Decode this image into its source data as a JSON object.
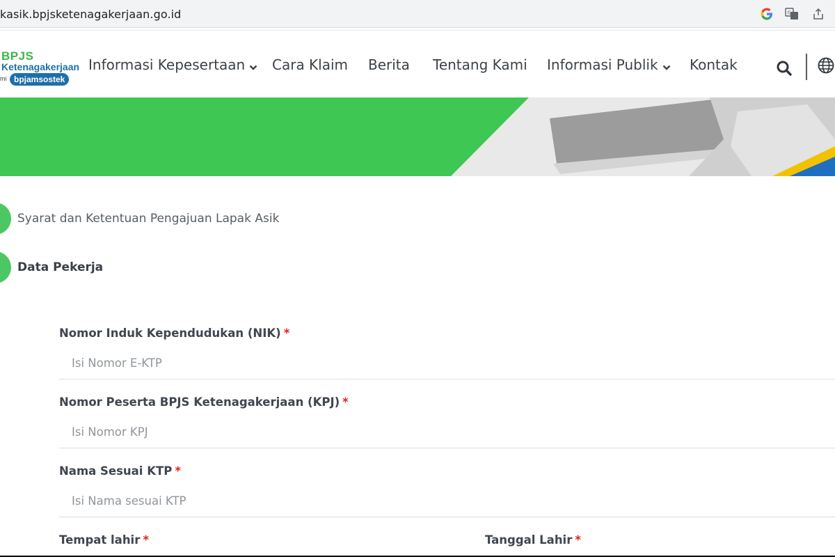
{
  "browser": {
    "url": "kasik.bpjsketenagakerjaan.go.id",
    "icons": [
      "google-icon",
      "translate-icon",
      "share-icon"
    ]
  },
  "header": {
    "logo": {
      "line1": "BPJS",
      "line2": "Ketenagakerjaan",
      "small": "mi",
      "pill": "bpjamsostek"
    },
    "nav": [
      {
        "label": "Informasi Kepesertaan",
        "has_dropdown": true
      },
      {
        "label": "Cara Klaim",
        "has_dropdown": false
      },
      {
        "label": "Berita",
        "has_dropdown": false
      },
      {
        "label": "Tentang Kami",
        "has_dropdown": false
      },
      {
        "label": "Informasi Publik",
        "has_dropdown": true
      },
      {
        "label": "Kontak",
        "has_dropdown": false
      }
    ],
    "icons": [
      "search-icon",
      "globe-icon"
    ]
  },
  "colors": {
    "brand_green": "#3ec752",
    "brand_blue": "#1e6fa8",
    "required_red": "#e02020"
  },
  "steps": [
    {
      "label": "Syarat dan Ketentuan Pengajuan Lapak Asik",
      "active": false
    },
    {
      "label": "Data Pekerja",
      "active": true
    }
  ],
  "form": {
    "nik": {
      "label": "Nomor Induk Kependudukan (NIK)",
      "required_mark": "*",
      "placeholder": "Isi Nomor E-KTP",
      "value": ""
    },
    "kpj": {
      "label": "Nomor Peserta BPJS Ketenagakerjaan (KPJ)",
      "required_mark": "*",
      "placeholder": "Isi Nomor KPJ",
      "value": ""
    },
    "nama": {
      "label": "Nama Sesuai KTP",
      "required_mark": "*",
      "placeholder": "Isi Nama sesuai KTP",
      "value": ""
    },
    "tempat_lahir": {
      "label": "Tempat lahir",
      "required_mark": "*"
    },
    "tanggal_lahir": {
      "label": "Tanggal Lahir",
      "required_mark": "*"
    }
  }
}
